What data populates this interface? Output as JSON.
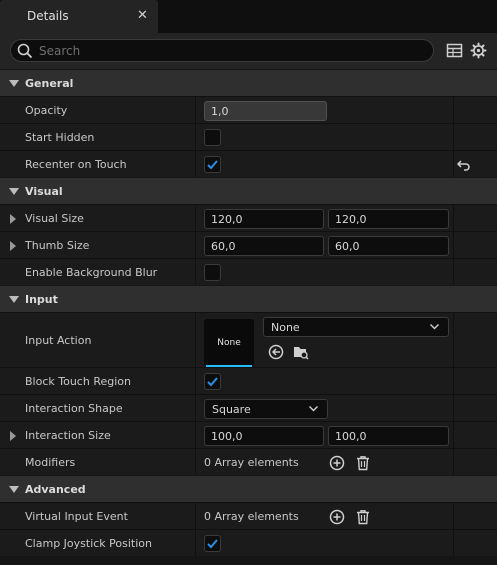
{
  "tab": {
    "title": "Details",
    "close": "✕"
  },
  "search": {
    "placeholder": "Search"
  },
  "categories": {
    "general": "General",
    "visual": "Visual",
    "input": "Input",
    "advanced": "Advanced"
  },
  "props": {
    "opacity": {
      "label": "Opacity",
      "value": "1,0"
    },
    "start_hidden": {
      "label": "Start Hidden",
      "checked": false
    },
    "recenter_on_touch": {
      "label": "Recenter on Touch",
      "checked": true
    },
    "visual_size": {
      "label": "Visual Size",
      "x": "120,0",
      "y": "120,0"
    },
    "thumb_size": {
      "label": "Thumb Size",
      "x": "60,0",
      "y": "60,0"
    },
    "enable_bg_blur": {
      "label": "Enable Background Blur",
      "checked": false
    },
    "input_action": {
      "label": "Input Action",
      "thumb_text": "None",
      "selected": "None"
    },
    "block_touch_region": {
      "label": "Block Touch Region",
      "checked": true
    },
    "interaction_shape": {
      "label": "Interaction Shape",
      "selected": "Square"
    },
    "interaction_size": {
      "label": "Interaction Size",
      "x": "100,0",
      "y": "100,0"
    },
    "modifiers": {
      "label": "Modifiers",
      "value": "0 Array elements"
    },
    "virtual_input_event": {
      "label": "Virtual Input Event",
      "value": "0 Array elements"
    },
    "clamp_joystick": {
      "label": "Clamp Joystick Position",
      "checked": true
    }
  },
  "colors": {
    "accent": "#26bbff",
    "check": "#2a8fe8",
    "background": "#1b1b1b",
    "category": "#2f2f2f"
  },
  "icons": [
    "search-icon",
    "table-view-icon",
    "settings-gear-icon",
    "reset-arrow-icon",
    "use-selected-icon",
    "browse-asset-icon",
    "add-element-icon",
    "delete-elements-icon"
  ]
}
